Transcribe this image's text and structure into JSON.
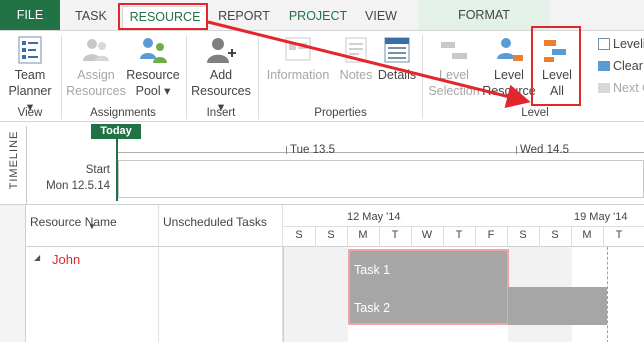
{
  "tabs": {
    "file": "FILE",
    "task": "TASK",
    "resource": "RESOURCE",
    "report": "REPORT",
    "project": "PROJECT",
    "view": "VIEW",
    "format": "FORMAT"
  },
  "ribbon": {
    "team_planner": [
      "Team",
      "Planner ▾"
    ],
    "assign_resources": [
      "Assign",
      "Resources"
    ],
    "resource_pool": [
      "Resource",
      "Pool ▾"
    ],
    "add_resources": [
      "Add",
      "Resources ▾"
    ],
    "information": "Information",
    "notes": "Notes",
    "details": "Details",
    "level_selection": [
      "Level",
      "Selection"
    ],
    "level_resource": [
      "Level",
      "Resource"
    ],
    "level_all": [
      "Level",
      "All"
    ],
    "leveling_options": "Leveling",
    "clear_leveling": "Clear Le",
    "next_overallocation": "Next Ov",
    "groups": {
      "view": "View",
      "assignments": "Assignments",
      "insert": "Insert",
      "properties": "Properties",
      "level": "Level"
    }
  },
  "timeline": {
    "side_label": "TIMELINE",
    "today": "Today",
    "start_label": "Start",
    "start_date": "Mon 12.5.14",
    "ticks": [
      "Tue 13.5",
      "Wed 14.5"
    ]
  },
  "grid": {
    "col_resource_name": "Resource Name",
    "col_unscheduled": "Unscheduled Tasks",
    "weeks": [
      "12 May '14",
      "19 May '14"
    ],
    "days": [
      "S",
      "S",
      "M",
      "T",
      "W",
      "T",
      "F",
      "S",
      "S",
      "M",
      "T"
    ],
    "resources": [
      {
        "name": "John",
        "tasks": [
          "Task 1",
          "Task 2"
        ]
      }
    ]
  },
  "colors": {
    "accent": "#217346",
    "highlight": "#e3262c",
    "task_bar": "#a6a6a6",
    "overallocated": "#f4a3a3"
  }
}
